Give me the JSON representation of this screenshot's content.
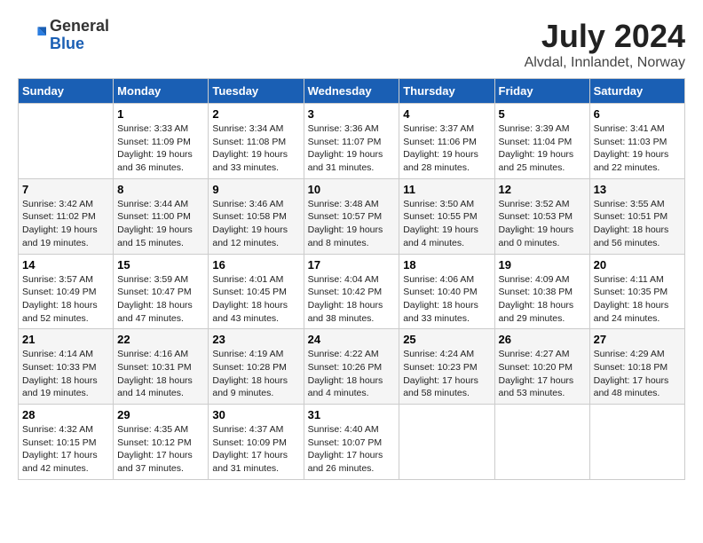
{
  "header": {
    "logo_general": "General",
    "logo_blue": "Blue",
    "title": "July 2024",
    "location": "Alvdal, Innlandet, Norway"
  },
  "weekdays": [
    "Sunday",
    "Monday",
    "Tuesday",
    "Wednesday",
    "Thursday",
    "Friday",
    "Saturday"
  ],
  "weeks": [
    [
      {
        "day": "",
        "sunrise": "",
        "sunset": "",
        "daylight": ""
      },
      {
        "day": "1",
        "sunrise": "Sunrise: 3:33 AM",
        "sunset": "Sunset: 11:09 PM",
        "daylight": "Daylight: 19 hours and 36 minutes."
      },
      {
        "day": "2",
        "sunrise": "Sunrise: 3:34 AM",
        "sunset": "Sunset: 11:08 PM",
        "daylight": "Daylight: 19 hours and 33 minutes."
      },
      {
        "day": "3",
        "sunrise": "Sunrise: 3:36 AM",
        "sunset": "Sunset: 11:07 PM",
        "daylight": "Daylight: 19 hours and 31 minutes."
      },
      {
        "day": "4",
        "sunrise": "Sunrise: 3:37 AM",
        "sunset": "Sunset: 11:06 PM",
        "daylight": "Daylight: 19 hours and 28 minutes."
      },
      {
        "day": "5",
        "sunrise": "Sunrise: 3:39 AM",
        "sunset": "Sunset: 11:04 PM",
        "daylight": "Daylight: 19 hours and 25 minutes."
      },
      {
        "day": "6",
        "sunrise": "Sunrise: 3:41 AM",
        "sunset": "Sunset: 11:03 PM",
        "daylight": "Daylight: 19 hours and 22 minutes."
      }
    ],
    [
      {
        "day": "7",
        "sunrise": "Sunrise: 3:42 AM",
        "sunset": "Sunset: 11:02 PM",
        "daylight": "Daylight: 19 hours and 19 minutes."
      },
      {
        "day": "8",
        "sunrise": "Sunrise: 3:44 AM",
        "sunset": "Sunset: 11:00 PM",
        "daylight": "Daylight: 19 hours and 15 minutes."
      },
      {
        "day": "9",
        "sunrise": "Sunrise: 3:46 AM",
        "sunset": "Sunset: 10:58 PM",
        "daylight": "Daylight: 19 hours and 12 minutes."
      },
      {
        "day": "10",
        "sunrise": "Sunrise: 3:48 AM",
        "sunset": "Sunset: 10:57 PM",
        "daylight": "Daylight: 19 hours and 8 minutes."
      },
      {
        "day": "11",
        "sunrise": "Sunrise: 3:50 AM",
        "sunset": "Sunset: 10:55 PM",
        "daylight": "Daylight: 19 hours and 4 minutes."
      },
      {
        "day": "12",
        "sunrise": "Sunrise: 3:52 AM",
        "sunset": "Sunset: 10:53 PM",
        "daylight": "Daylight: 19 hours and 0 minutes."
      },
      {
        "day": "13",
        "sunrise": "Sunrise: 3:55 AM",
        "sunset": "Sunset: 10:51 PM",
        "daylight": "Daylight: 18 hours and 56 minutes."
      }
    ],
    [
      {
        "day": "14",
        "sunrise": "Sunrise: 3:57 AM",
        "sunset": "Sunset: 10:49 PM",
        "daylight": "Daylight: 18 hours and 52 minutes."
      },
      {
        "day": "15",
        "sunrise": "Sunrise: 3:59 AM",
        "sunset": "Sunset: 10:47 PM",
        "daylight": "Daylight: 18 hours and 47 minutes."
      },
      {
        "day": "16",
        "sunrise": "Sunrise: 4:01 AM",
        "sunset": "Sunset: 10:45 PM",
        "daylight": "Daylight: 18 hours and 43 minutes."
      },
      {
        "day": "17",
        "sunrise": "Sunrise: 4:04 AM",
        "sunset": "Sunset: 10:42 PM",
        "daylight": "Daylight: 18 hours and 38 minutes."
      },
      {
        "day": "18",
        "sunrise": "Sunrise: 4:06 AM",
        "sunset": "Sunset: 10:40 PM",
        "daylight": "Daylight: 18 hours and 33 minutes."
      },
      {
        "day": "19",
        "sunrise": "Sunrise: 4:09 AM",
        "sunset": "Sunset: 10:38 PM",
        "daylight": "Daylight: 18 hours and 29 minutes."
      },
      {
        "day": "20",
        "sunrise": "Sunrise: 4:11 AM",
        "sunset": "Sunset: 10:35 PM",
        "daylight": "Daylight: 18 hours and 24 minutes."
      }
    ],
    [
      {
        "day": "21",
        "sunrise": "Sunrise: 4:14 AM",
        "sunset": "Sunset: 10:33 PM",
        "daylight": "Daylight: 18 hours and 19 minutes."
      },
      {
        "day": "22",
        "sunrise": "Sunrise: 4:16 AM",
        "sunset": "Sunset: 10:31 PM",
        "daylight": "Daylight: 18 hours and 14 minutes."
      },
      {
        "day": "23",
        "sunrise": "Sunrise: 4:19 AM",
        "sunset": "Sunset: 10:28 PM",
        "daylight": "Daylight: 18 hours and 9 minutes."
      },
      {
        "day": "24",
        "sunrise": "Sunrise: 4:22 AM",
        "sunset": "Sunset: 10:26 PM",
        "daylight": "Daylight: 18 hours and 4 minutes."
      },
      {
        "day": "25",
        "sunrise": "Sunrise: 4:24 AM",
        "sunset": "Sunset: 10:23 PM",
        "daylight": "Daylight: 17 hours and 58 minutes."
      },
      {
        "day": "26",
        "sunrise": "Sunrise: 4:27 AM",
        "sunset": "Sunset: 10:20 PM",
        "daylight": "Daylight: 17 hours and 53 minutes."
      },
      {
        "day": "27",
        "sunrise": "Sunrise: 4:29 AM",
        "sunset": "Sunset: 10:18 PM",
        "daylight": "Daylight: 17 hours and 48 minutes."
      }
    ],
    [
      {
        "day": "28",
        "sunrise": "Sunrise: 4:32 AM",
        "sunset": "Sunset: 10:15 PM",
        "daylight": "Daylight: 17 hours and 42 minutes."
      },
      {
        "day": "29",
        "sunrise": "Sunrise: 4:35 AM",
        "sunset": "Sunset: 10:12 PM",
        "daylight": "Daylight: 17 hours and 37 minutes."
      },
      {
        "day": "30",
        "sunrise": "Sunrise: 4:37 AM",
        "sunset": "Sunset: 10:09 PM",
        "daylight": "Daylight: 17 hours and 31 minutes."
      },
      {
        "day": "31",
        "sunrise": "Sunrise: 4:40 AM",
        "sunset": "Sunset: 10:07 PM",
        "daylight": "Daylight: 17 hours and 26 minutes."
      },
      {
        "day": "",
        "sunrise": "",
        "sunset": "",
        "daylight": ""
      },
      {
        "day": "",
        "sunrise": "",
        "sunset": "",
        "daylight": ""
      },
      {
        "day": "",
        "sunrise": "",
        "sunset": "",
        "daylight": ""
      }
    ]
  ]
}
